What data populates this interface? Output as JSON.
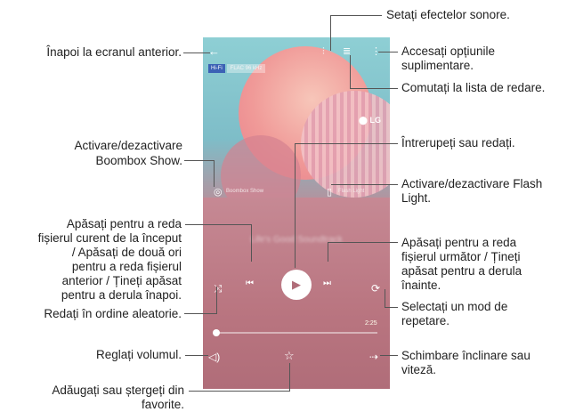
{
  "screen": {
    "badge_hifi": "Hi-Fi",
    "badge_meta": "FLAC 96 kHz",
    "brand": "⬤ LG",
    "boombox_label": "Boombox Show",
    "flashlight_label": "Flash Light",
    "song_title": "Life's Good Soundtrack",
    "song_artist": "LG",
    "time_total": "2:25",
    "icons": {
      "back": "back-arrow-icon",
      "equalizer": "equalizer-icon",
      "playlist": "playlist-icon",
      "more": "more-options-icon",
      "boombox": "boombox-icon",
      "flashlight": "flashlight-icon",
      "prev": "previous-track-icon",
      "play": "play-icon",
      "next": "next-track-icon",
      "shuffle": "shuffle-icon",
      "repeat": "repeat-icon",
      "volume": "volume-icon",
      "favorite": "star-icon",
      "speed": "speed-pitch-icon"
    }
  },
  "callouts": {
    "back": "Înapoi la ecranul anterior.",
    "boombox_1": "Activare/dezactivare",
    "boombox_2": "Boombox Show.",
    "prev_1": "Apăsați pentru a reda",
    "prev_2": "fișierul curent de la început",
    "prev_3": "/ Apăsați de două ori",
    "prev_4": "pentru a reda fișierul",
    "prev_5": "anterior / Țineți apăsat",
    "prev_6": "pentru a derula înapoi.",
    "shuffle": "Redați în ordine aleatorie.",
    "volume": "Reglați volumul.",
    "favorite_1": "Adăugați sau ștergeți din",
    "favorite_2": "favorite.",
    "equalizer": "Setați efectelor sonore.",
    "more_1": "Accesați opțiunile",
    "more_2": "suplimentare.",
    "playlist": "Comutați la lista de redare.",
    "play": "Întrerupeți sau redați.",
    "flashlight_1": "Activare/dezactivare Flash",
    "flashlight_2": "Light.",
    "next_1": "Apăsați pentru a reda",
    "next_2": "fișierul următor / Țineți",
    "next_3": "apăsat pentru a derula",
    "next_4": "înainte.",
    "repeat_1": "Selectați un mod de",
    "repeat_2": "repetare.",
    "speed_1": "Schimbare înclinare sau",
    "speed_2": "viteză."
  },
  "seek_progress": 0.02
}
